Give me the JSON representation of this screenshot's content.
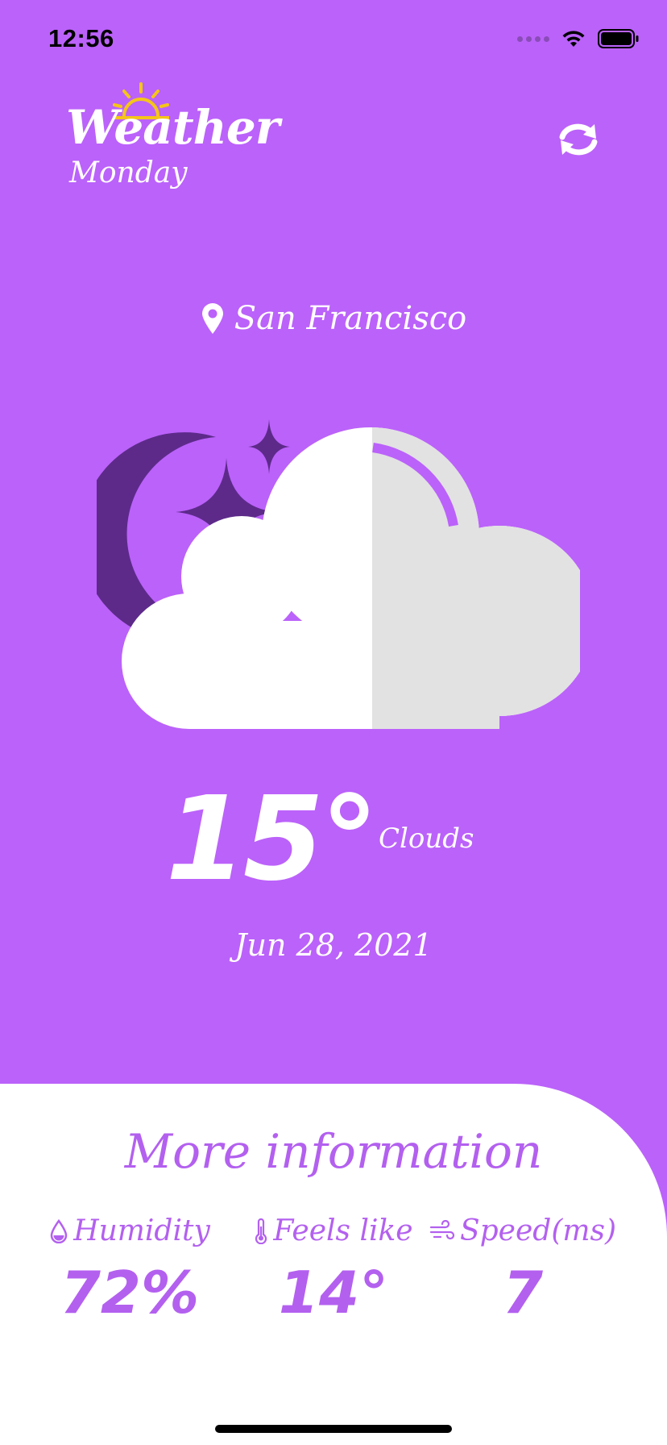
{
  "status_bar": {
    "time": "12:56"
  },
  "header": {
    "app_title": "Weather",
    "day": "Monday"
  },
  "location": {
    "city": "San Francisco"
  },
  "current": {
    "temperature": "15°",
    "description": "Clouds",
    "date": "Jun 28, 2021"
  },
  "more_info": {
    "title": "More information",
    "metrics": [
      {
        "label": "Humidity",
        "value": "72%",
        "icon": "water-drop-icon"
      },
      {
        "label": "Feels like",
        "value": "14°",
        "icon": "thermometer-icon"
      },
      {
        "label": "Speed(ms)",
        "value": "7",
        "icon": "wind-icon"
      }
    ]
  },
  "colors": {
    "background": "#bb62fa",
    "accent": "#b360ef",
    "moon": "#5d2a8a",
    "cloud_light": "#ffffff",
    "cloud_shade": "#e2e2e2",
    "sun": "#f5c518"
  }
}
